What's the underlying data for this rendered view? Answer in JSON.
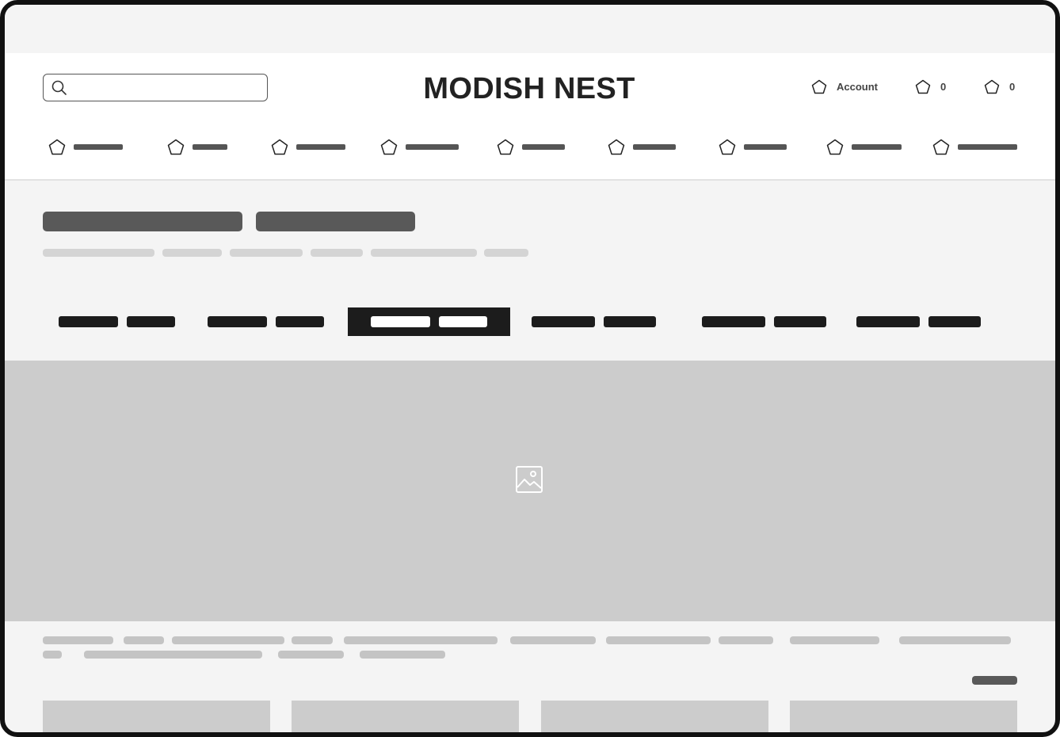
{
  "header": {
    "brand": "MODISH NEST",
    "search": {
      "placeholder": "",
      "icon": "search-icon"
    },
    "account_label": "Account",
    "wishlist_count": "0",
    "cart_count": "0"
  },
  "nav": {
    "icon": "pentagon-icon",
    "items_count_visible": 9
  },
  "tabs": {
    "active_index": 2,
    "count": 6
  },
  "hero": {
    "icon": "image-placeholder-icon"
  },
  "colors": {
    "background": "#f4f4f4",
    "header_bg": "#ffffff",
    "placeholder": "#cccccc",
    "skeleton_dark": "#595959",
    "skeleton_light": "#d4d4d4",
    "tab_dark": "#1c1c1c",
    "frame": "#111111"
  }
}
